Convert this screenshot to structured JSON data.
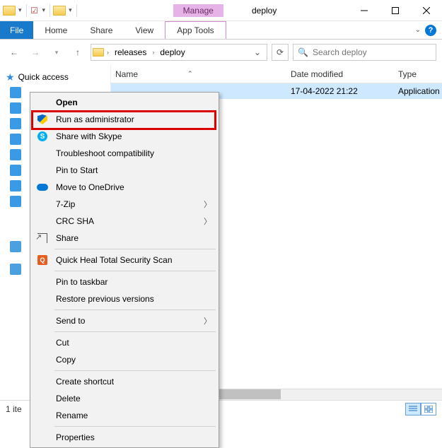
{
  "window": {
    "contextual_tab": "Manage",
    "title": "deploy"
  },
  "ribbon": {
    "file": "File",
    "tabs": [
      "Home",
      "Share",
      "View"
    ],
    "tool_tab": "App Tools"
  },
  "breadcrumb": {
    "segments": [
      "releases",
      "deploy"
    ]
  },
  "search": {
    "placeholder": "Search deploy"
  },
  "sidebar": {
    "quick_access": "Quick access"
  },
  "columns": {
    "name": "Name",
    "date": "Date modified",
    "type": "Type"
  },
  "files": [
    {
      "name": "",
      "date": "17-04-2022 21:22",
      "type": "Application"
    }
  ],
  "statusbar": {
    "count": "1 ite"
  },
  "context_menu": {
    "open": "Open",
    "run_admin": "Run as administrator",
    "skype": "Share with Skype",
    "troubleshoot": "Troubleshoot compatibility",
    "pin_start": "Pin to Start",
    "onedrive": "Move to OneDrive",
    "sevenzip": "7-Zip",
    "crc": "CRC SHA",
    "share": "Share",
    "quickheal": "Quick Heal Total Security Scan",
    "pin_taskbar": "Pin to taskbar",
    "restore": "Restore previous versions",
    "sendto": "Send to",
    "cut": "Cut",
    "copy": "Copy",
    "shortcut": "Create shortcut",
    "delete": "Delete",
    "rename": "Rename",
    "properties": "Properties"
  }
}
